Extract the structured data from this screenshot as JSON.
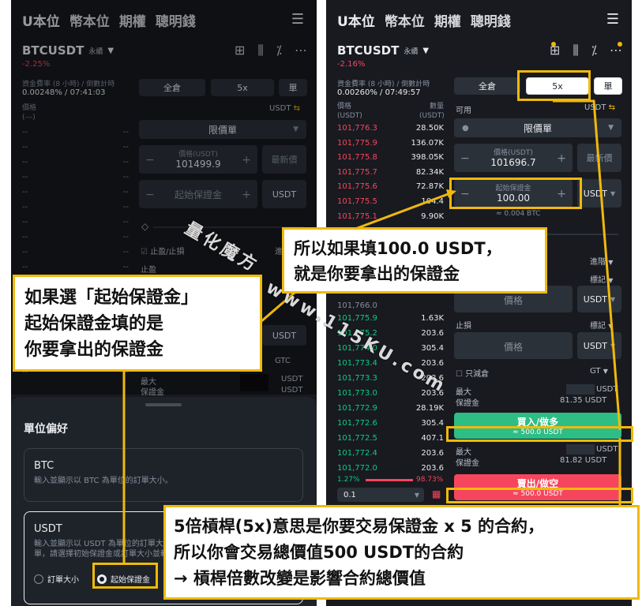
{
  "nav": {
    "tabs": [
      "U本位",
      "幣本位",
      "期權",
      "聰明錢"
    ]
  },
  "left": {
    "symbol": "BTCUSDT",
    "perp": "永續",
    "change": "-2.25%",
    "funding_label": "資金費率 (8 小時) / 倒數計時",
    "funding_value": "0.00248% / 07:41:03",
    "price_label": "價格",
    "price_unit": "(---)",
    "margin_mode": "全倉",
    "leverage": "5x",
    "position_mode": "單",
    "available_unit": "USDT",
    "order_type": "限價單",
    "price_input_label": "價格(USDT)",
    "price_input_value": "101499.9",
    "buy_label": "最新價",
    "initial_margin_label": "起始保證金",
    "margin_unit": "USDT",
    "tp_sl": "止盈/止損",
    "stop_profit": "止盈",
    "advanced": "進階",
    "gtc": "GTC",
    "unit_usdt": "USDT",
    "max_label": "最大",
    "margin_label": "保證金",
    "dashes": [
      "--",
      "--",
      "--",
      "--",
      "--",
      "--",
      "--",
      "--",
      "--",
      "--",
      "--",
      "--",
      "--",
      "--",
      "--",
      "--",
      "--"
    ]
  },
  "sheet": {
    "title": "單位偏好",
    "btc_title": "BTC",
    "btc_desc": "輸入並顯示以 BTC 為單位的訂單大小。",
    "usdt_title": "USDT",
    "usdt_desc1": "輸入並顯示以 USDT 為單位的訂單大小。在下",
    "usdt_desc2": "單，請選擇初始保證金或訂單大小並輸入",
    "radio_order_size": "訂單大小",
    "radio_initial_margin": "起始保證金"
  },
  "right": {
    "symbol": "BTCUSDT",
    "perp": "永續",
    "change": "-2.16%",
    "funding_label": "資金費率 (8 小時) / 倒數計時",
    "funding_value": "0.00260% / 07:49:57",
    "col_price": "價格",
    "col_price_unit": "(USDT)",
    "col_qty": "數量",
    "col_qty_unit": "(USDT)",
    "margin_mode": "全倉",
    "leverage": "5x",
    "position_mode": "單",
    "available_label": "可用",
    "available_unit": "USDT",
    "order_type": "限價單",
    "price_input_label": "價格(USDT)",
    "price_input_value": "101696.7",
    "buy_label": "最新價",
    "initial_margin_label": "起始保證金",
    "initial_margin_value": "100.00",
    "margin_unit": "USDT",
    "btc_equiv": "≈ 0.004 BTC",
    "asks": [
      {
        "p": "101,776.3",
        "q": "28.50K"
      },
      {
        "p": "101,775.9",
        "q": "136.07K"
      },
      {
        "p": "101,775.8",
        "q": "398.05K"
      },
      {
        "p": "101,775.7",
        "q": "82.34K"
      },
      {
        "p": "101,775.6",
        "q": "72.87K"
      },
      {
        "p": "101,775.5",
        "q": "104.4"
      },
      {
        "p": "101,775.1",
        "q": "9.90K"
      }
    ],
    "mid_price": "101,766.0",
    "bids": [
      {
        "p": "101,775.9",
        "q": "1.63K"
      },
      {
        "p": "101,775.2",
        "q": "203.6"
      },
      {
        "p": "101,774.0",
        "q": "305.4"
      },
      {
        "p": "101,773.4",
        "q": "203.6"
      },
      {
        "p": "101,773.3",
        "q": "203.6"
      },
      {
        "p": "101,773.0",
        "q": "203.6"
      },
      {
        "p": "101,772.9",
        "q": "28.19K"
      },
      {
        "p": "101,772.6",
        "q": "305.4"
      },
      {
        "p": "101,772.5",
        "q": "407.1"
      },
      {
        "p": "101,772.4",
        "q": "203.6"
      },
      {
        "p": "101,772.0",
        "q": "203.6"
      }
    ],
    "depth_left": "1.27%",
    "depth_right": "98.73%",
    "tick_size": "0.1",
    "advanced": "進階",
    "mark": "標記",
    "tp_price": "價格",
    "stop_loss": "止損",
    "sl_price": "價格",
    "reduce_only": "只減倉",
    "gtc": "GT",
    "max_label": "最大",
    "margin_label": "保證金",
    "max_margin_1": "81.35 USDT",
    "buy_button": "買入/做多",
    "buy_value": "≈ 500.0 USDT",
    "max_margin_2": "81.82 USDT",
    "sell_button": "賣出/做空",
    "sell_value": "≈ 500.0 USDT",
    "unit_usdt": "USDT"
  },
  "annotations": {
    "callout_left_1": "如果選「起始保證金」",
    "callout_left_2": "起始保證金填的是",
    "callout_left_3": "你要拿出的保證金",
    "callout_mid_1": "所以如果填100.0 USDT，",
    "callout_mid_2": "就是你要拿出的保證金",
    "callout_bottom_1": "5倍槓桿(5x)意思是你要交易保證金 x 5 的合約，",
    "callout_bottom_2": "所以你會交易總價值500 USDT的合約",
    "callout_bottom_3": "→ 槓桿倍數改變是影響合約總價值",
    "watermark_1": "量化魔方",
    "watermark_2": "www.115KU.com"
  },
  "colors": {
    "accent": "#f0b90b",
    "buy": "#2ebd85",
    "sell": "#f6465d",
    "bg": "#181a20"
  }
}
